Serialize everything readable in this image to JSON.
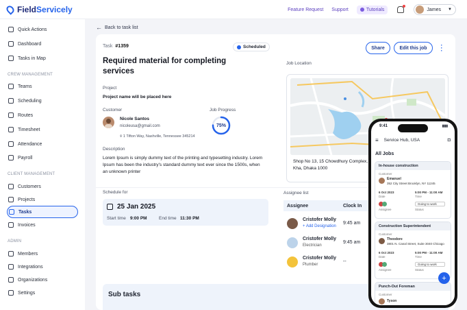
{
  "brand": {
    "name_part1": "Field",
    "name_part2": "Servicely"
  },
  "topbar": {
    "feature_request": "Feature Request",
    "support": "Support",
    "tutorials": "Tutorials",
    "user_name": "James"
  },
  "sidebar": {
    "quick_actions": "Quick Actions",
    "dashboard": "Dashboard",
    "tasks_in_map": "Tasks in Map",
    "section_crew": "CREW MANAGEMENT",
    "teams": "Teams",
    "scheduling": "Scheduling",
    "routes": "Routes",
    "timesheet": "Timesheet",
    "attendance": "Attendance",
    "payroll": "Payroll",
    "section_client": "CLIENT MANAGEMENT",
    "customers": "Customers",
    "projects": "Projects",
    "tasks": "Tasks",
    "invoices": "Invoices",
    "section_admin": "ADMIN",
    "members": "Members",
    "integrations": "Integrations",
    "organizations": "Organizations",
    "settings": "Settings"
  },
  "task": {
    "back": "Back to task list",
    "label": "Task",
    "number": "#1359",
    "status": "Scheduled",
    "share": "Share",
    "edit": "Edit this job",
    "title": "Required material for completing services",
    "project_label": "Project",
    "project_value": "Project name will be placed here",
    "customer_label": "Customer",
    "customer_name": "Nicole Santos",
    "customer_email": "nicoleusa@gmail.com",
    "customer_address": "1 Tifton Way, Nashville, Tennessee 345214",
    "progress_label": "Job Progress",
    "progress_text": "75%",
    "progress_value": 0.75,
    "description_label": "Description",
    "description": "Lorem Ipsum is simply dummy text of the printing and typesetting industry. Lorem Ipsum has been the industry's standard dummy text ever since the 1500s, when an unknown printer",
    "location_label": "Job Location",
    "location_address": "Shop No 13, 15 Chowdhury Complex, 113 Kha, Dhaka 1000",
    "schedule_label": "Schedule for",
    "schedule_date": "25 Jan 2025",
    "start_label": "Start time",
    "start_value": "9:00 PM",
    "end_label": "End time",
    "end_value": "11:30 PM",
    "assignee_label": "Assignee list",
    "col_assignee": "Assignee",
    "col_clockin": "Clock In",
    "assignees": [
      {
        "name": "Cristofer Molly",
        "sub": "+ Add Designation",
        "time": "9:45 am"
      },
      {
        "name": "Cristofer Molly",
        "sub": "Electrician",
        "time": "9:45 am"
      },
      {
        "name": "Cristofer Molly",
        "sub": "Plumber",
        "time": "--"
      }
    ],
    "subtasks_heading": "Sub tasks"
  },
  "phone": {
    "time": "9:41",
    "hub": "Service Hub, USA",
    "all_jobs": "All Jobs",
    "jobs": [
      {
        "title": "In-house construction",
        "customer_label": "Customer",
        "customer": "Emanuel",
        "address": "352 City Street Brooklyn, NY 11245",
        "date": "6 Oct 2023",
        "date_label": "Date",
        "time": "5:00 PM - 11:00 AM",
        "time_label": "Time",
        "assignee_label": "Assignee",
        "status": "Going to work",
        "status_label": "Status"
      },
      {
        "title": "Construction Superintendent",
        "customer_label": "Customer",
        "customer": "Theodore",
        "address": "3801 N. Canal Street, Suite 3040 Chicago",
        "date": "6 Oct 2023",
        "date_label": "Date",
        "time": "5:00 PM - 11:00 AM",
        "time_label": "Time",
        "assignee_label": "Assignee",
        "status": "Going to work",
        "status_label": "Status"
      },
      {
        "title": "Punch-Out Foreman",
        "customer_label": "Customer",
        "customer": "Tyson"
      }
    ]
  },
  "colors": {
    "brand_blue": "#2563eb",
    "navy": "#1e3a8a",
    "accent_purple": "#5b3fbf",
    "panel_bg": "#eef3fb"
  }
}
